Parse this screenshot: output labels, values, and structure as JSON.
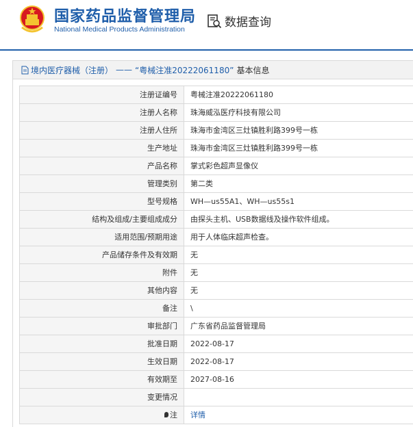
{
  "header": {
    "org_cn": "国家药品监督管理局",
    "org_en": "National Medical Products Administration",
    "query_label": "数据查询"
  },
  "breadcrumb": {
    "category": "境内医疗器械（注册）",
    "separator": "——",
    "record": "“粤械注准20222061180”",
    "suffix": "基本信息"
  },
  "fields": [
    {
      "label": "注册证编号",
      "value": "粤械注准20222061180"
    },
    {
      "label": "注册人名称",
      "value": "珠海威泓医疗科技有限公司"
    },
    {
      "label": "注册人住所",
      "value": "珠海市金湾区三灶镇胜利路399号一栋"
    },
    {
      "label": "生产地址",
      "value": "珠海市金湾区三灶镇胜利路399号一栋"
    },
    {
      "label": "产品名称",
      "value": "掌式彩色超声显像仪"
    },
    {
      "label": "管理类别",
      "value": "第二类"
    },
    {
      "label": "型号规格",
      "value": "WH—us55A1、WH—us55s1"
    },
    {
      "label": "结构及组成/主要组成成分",
      "value": "由探头主机、USB数据线及操作软件组成。"
    },
    {
      "label": "适用范围/预期用途",
      "value": "用于人体临床超声检查。"
    },
    {
      "label": "产品储存条件及有效期",
      "value": "无"
    },
    {
      "label": "附件",
      "value": "无"
    },
    {
      "label": "其他内容",
      "value": "无"
    },
    {
      "label": "备注",
      "value": "\\"
    },
    {
      "label": "审批部门",
      "value": "广东省药品监督管理局"
    },
    {
      "label": "批准日期",
      "value": "2022-08-17"
    },
    {
      "label": "生效日期",
      "value": "2022-08-17"
    },
    {
      "label": "有效期至",
      "value": "2027-08-16"
    },
    {
      "label": "变更情况",
      "value": ""
    },
    {
      "label": "注",
      "value": "详情",
      "link": true,
      "icon": "pin-icon"
    }
  ],
  "colors": {
    "brand": "#1f5eaa",
    "emblem_red": "#d71920",
    "emblem_gold": "#f4c430"
  }
}
